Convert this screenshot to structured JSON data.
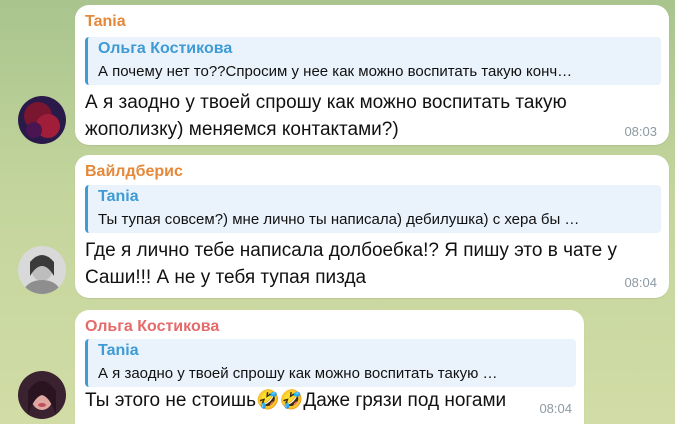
{
  "messages": [
    {
      "sender": "Tania",
      "sender_color": "#e5883a",
      "reply": {
        "name": "Ольга Костикова",
        "text": "А почему нет то??Спросим у нее как можно воспитать такую конч…"
      },
      "text_lines": [
        "А я заодно у твоей спрошу как можно воспитать такую",
        "жополизку) меняемся контактами?)"
      ],
      "time": "08:03",
      "avatar": "avatar-dark-red"
    },
    {
      "sender": "Вайлдберис",
      "sender_color": "#e5883a",
      "reply": {
        "name": "Tania",
        "text": "Ты тупая совсем?) мне лично ты написала) дебилушка) с хера бы …"
      },
      "text_lines": [
        "Где я лично тебе написала долбоебка!? Я пишу это в чате у",
        "Саши!!! А не у тебя тупая пизда"
      ],
      "time": "08:04",
      "avatar": "avatar-grey-portrait"
    },
    {
      "sender": "Ольга Костикова",
      "sender_color": "#e56a6a",
      "reply": {
        "name": "Tania",
        "text": "А я заодно у твоей спрошу как можно воспитать такую …"
      },
      "text_lines": [
        "Ты этого не стоишь🤣🤣Даже грязи под ногами"
      ],
      "time": "08:04",
      "avatar": "avatar-pink-portrait"
    }
  ]
}
